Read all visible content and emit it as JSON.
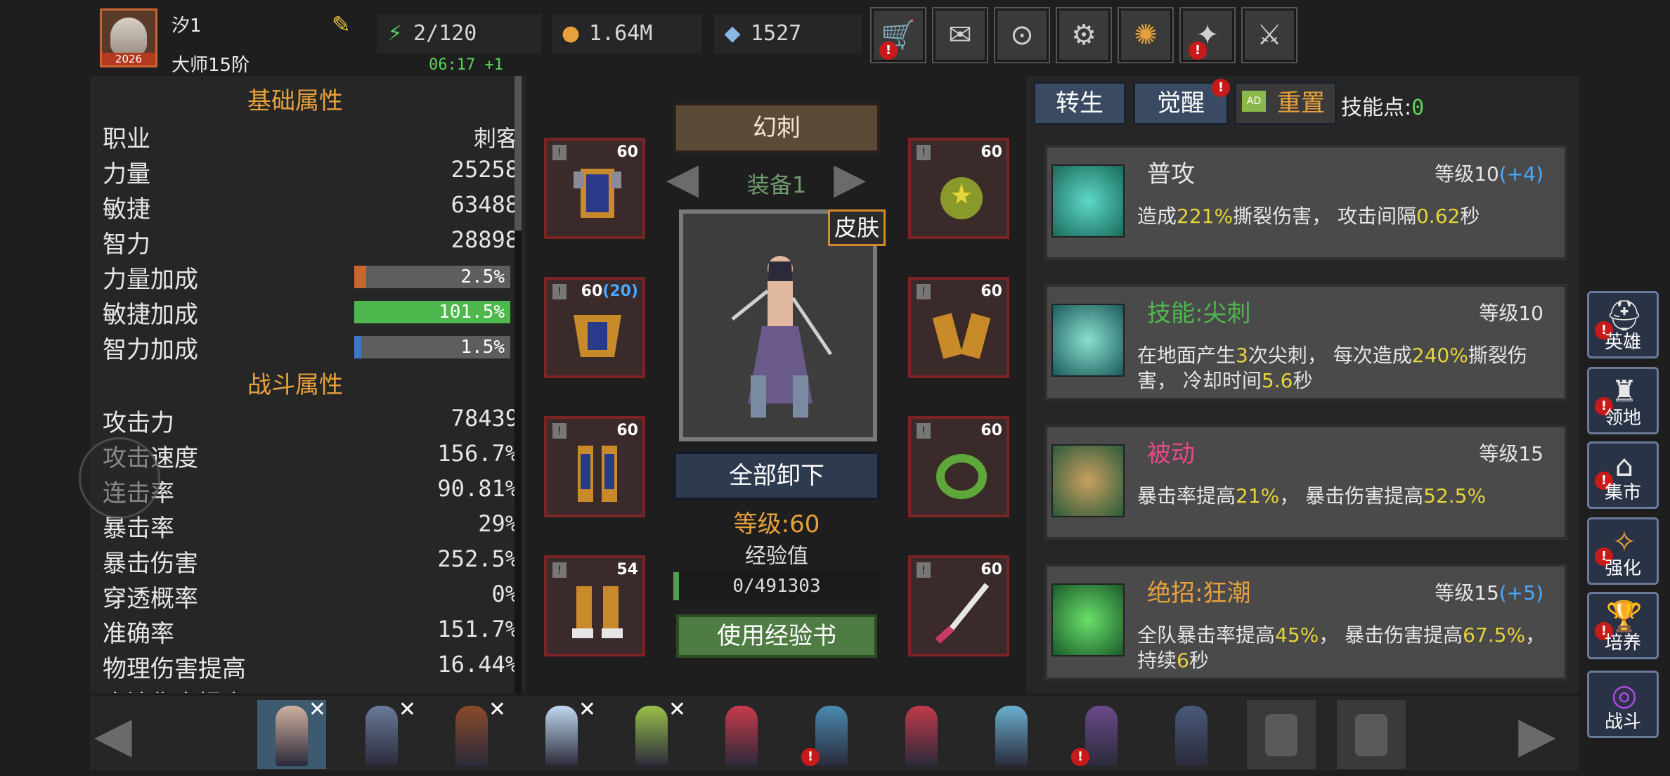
{
  "player": {
    "name": "汐1",
    "rank": "大师15阶",
    "avatar_year": "2026",
    "timer": "06:17 +1"
  },
  "resources": [
    {
      "icon": "energy-icon",
      "value": "2/120"
    },
    {
      "icon": "gold-icon",
      "value": "1.64M"
    },
    {
      "icon": "diamond-icon",
      "value": "1527"
    }
  ],
  "top_buttons": [
    "shop-cart-icon",
    "mail-icon",
    "gamepad-icon",
    "gear-icon",
    "color-wheel-icon",
    "gift-icon",
    "swords-icon"
  ],
  "stats": {
    "basic_title": "基础属性",
    "combat_title": "战斗属性",
    "class": {
      "label": "职业",
      "value": "刺客"
    },
    "basic": [
      {
        "label": "力量",
        "value": "25258"
      },
      {
        "label": "敏捷",
        "value": "63488"
      },
      {
        "label": "智力",
        "value": "28898"
      }
    ],
    "bonuses": [
      {
        "label": "力量加成",
        "value": "2.5%",
        "fraction": 0.025,
        "color": "#c9652f"
      },
      {
        "label": "敏捷加成",
        "value": "101.5%",
        "fraction": 1.0,
        "color": "#4eb84e"
      },
      {
        "label": "智力加成",
        "value": "1.5%",
        "fraction": 0.015,
        "color": "#3a78c9"
      }
    ],
    "combat": [
      {
        "label": "攻击力",
        "value": "78439"
      },
      {
        "label": "攻击速度",
        "value": "156.7%"
      },
      {
        "label": "连击率",
        "value": "90.81%"
      },
      {
        "label": "暴击率",
        "value": "29%"
      },
      {
        "label": "暴击伤害",
        "value": "252.5%"
      },
      {
        "label": "穿透概率",
        "value": "0%"
      },
      {
        "label": "准确率",
        "value": "151.7%"
      },
      {
        "label": "物理伤害提高",
        "value": "16.44%"
      },
      {
        "label": "魔法伤害提高",
        "value": ""
      }
    ]
  },
  "equipment": {
    "class_name": "幻刺",
    "set_name": "装备1",
    "skin": "皮肤",
    "unequip_all": "全部卸下",
    "level_label": "等级:60",
    "exp_label": "经验值",
    "exp_value": "0/491303",
    "exp_fraction": 0.0,
    "use_exp_book": "使用经验书",
    "left_slots": [
      {
        "level": "60",
        "extra": ""
      },
      {
        "level": "60",
        "extra": "(20)"
      },
      {
        "level": "60",
        "extra": ""
      },
      {
        "level": "54",
        "extra": ""
      }
    ],
    "right_slots": [
      {
        "level": "60"
      },
      {
        "level": "60"
      },
      {
        "level": "60"
      },
      {
        "level": "60"
      }
    ]
  },
  "skills": {
    "tabs": [
      "转生",
      "觉醒",
      "重置"
    ],
    "points_label": "技能点:",
    "points": "0",
    "list": [
      {
        "name": "普攻",
        "name_color": "#e6e6e6",
        "level": "等级10",
        "bonus": "(+4)",
        "desc": [
          "造成",
          "221%",
          "撕裂伤害， 攻击间隔",
          "0.62",
          "秒"
        ]
      },
      {
        "name": "技能:尖刺",
        "name_color": "#4eb84e",
        "level": "等级10",
        "bonus": "",
        "desc": [
          "在地面产生",
          "3",
          "次尖刺， 每次造成",
          "240%",
          "撕裂伤害， 冷却时间",
          "5.6",
          "秒"
        ]
      },
      {
        "name": "被动",
        "name_color": "#e64a8a",
        "level": "等级15",
        "bonus": "",
        "desc": [
          "暴击率提高",
          "21%",
          "， 暴击伤害提高",
          "52.5%",
          ""
        ]
      },
      {
        "name": "绝招:狂潮",
        "name_color": "#e6a13c",
        "level": "等级15",
        "bonus": "(+5)",
        "desc": [
          "全队暴击率提高",
          "45%",
          "， 暴击伤害提高",
          "67.5%",
          "， 持续",
          "6",
          "秒"
        ]
      }
    ]
  },
  "nav": [
    {
      "label": "英雄",
      "icon": "helmet-icon"
    },
    {
      "label": "领地",
      "icon": "castle-icon"
    },
    {
      "label": "集市",
      "icon": "market-icon"
    },
    {
      "label": "强化",
      "icon": "enhance-icon"
    },
    {
      "label": "培养",
      "icon": "chalice-icon"
    },
    {
      "label": "战斗",
      "icon": "portal-icon"
    }
  ]
}
